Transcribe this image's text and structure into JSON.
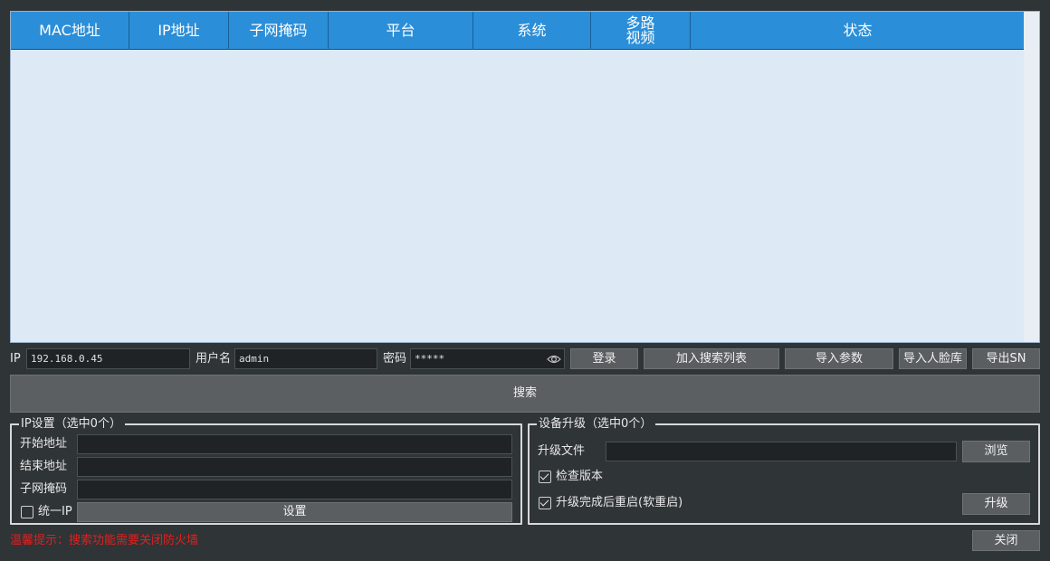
{
  "table": {
    "columns": [
      "MAC地址",
      "IP地址",
      "子网掩码",
      "平台",
      "系统",
      "多路\n视频",
      "状态"
    ],
    "rows": []
  },
  "login": {
    "ip_label": "IP",
    "ip_value": "192.168.0.45",
    "user_label": "用户名",
    "user_value": "admin",
    "pass_label": "密码",
    "pass_value": "*****",
    "eye_icon": "eye-icon",
    "login_button": "登录",
    "add_search_list_button": "加入搜索列表",
    "import_params_button": "导入参数",
    "import_face_db_button": "导入人脸库",
    "export_sn_button": "导出SN"
  },
  "search": {
    "label": "搜索"
  },
  "ip_settings": {
    "title": "IP设置（选中0个）",
    "start_label": "开始地址",
    "start_value": "",
    "end_label": "结束地址",
    "end_value": "",
    "mask_label": "子网掩码",
    "mask_value": "",
    "unify_ip_label": "统一IP",
    "unify_ip_checked": false,
    "set_button": "设置"
  },
  "upgrade": {
    "title": "设备升级（选中0个）",
    "file_label": "升级文件",
    "file_value": "",
    "browse_button": "浏览",
    "check_version_label": "检查版本",
    "check_version_checked": true,
    "reboot_label": "升级完成后重启(软重启)",
    "reboot_checked": true,
    "upgrade_button": "升级"
  },
  "footer": {
    "warning": "温馨提示：搜索功能需要关闭防火墙",
    "close_button": "关闭"
  },
  "colors": {
    "background": "#2f3436",
    "header_blue": "#2b8ed8",
    "table_bg": "#dde9f5",
    "button_gray": "#5a5e60",
    "warning_red": "#e02020"
  }
}
